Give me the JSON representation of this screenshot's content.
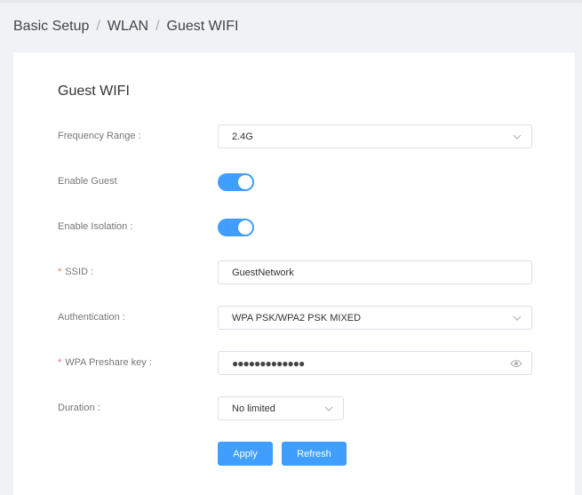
{
  "breadcrumb": {
    "items": [
      "Basic Setup",
      "WLAN",
      "Guest WIFI"
    ],
    "separator": "/"
  },
  "card": {
    "title": "Guest WIFI"
  },
  "form": {
    "frequency_range": {
      "label": "Frequency Range :",
      "value": "2.4G"
    },
    "enable_guest": {
      "label": "Enable Guest",
      "on": true
    },
    "enable_isolation": {
      "label": "Enable Isolation :",
      "on": true
    },
    "ssid": {
      "required_mark": "*",
      "label": "SSID :",
      "value": "GuestNetwork"
    },
    "authentication": {
      "label": "Authentication :",
      "value": "WPA PSK/WPA2 PSK MIXED"
    },
    "wpa_key": {
      "required_mark": "*",
      "label": "WPA Preshare key :",
      "masked_value": "●●●●●●●●●●●●●"
    },
    "duration": {
      "label": "Duration :",
      "value": "No limited"
    }
  },
  "buttons": {
    "apply": "Apply",
    "refresh": "Refresh"
  },
  "colors": {
    "accent": "#409eff",
    "required": "#f56c6c",
    "background": "#f0f2f5"
  },
  "icons": {
    "select_arrow": "chevron-down-icon",
    "password_toggle": "eye-icon"
  }
}
